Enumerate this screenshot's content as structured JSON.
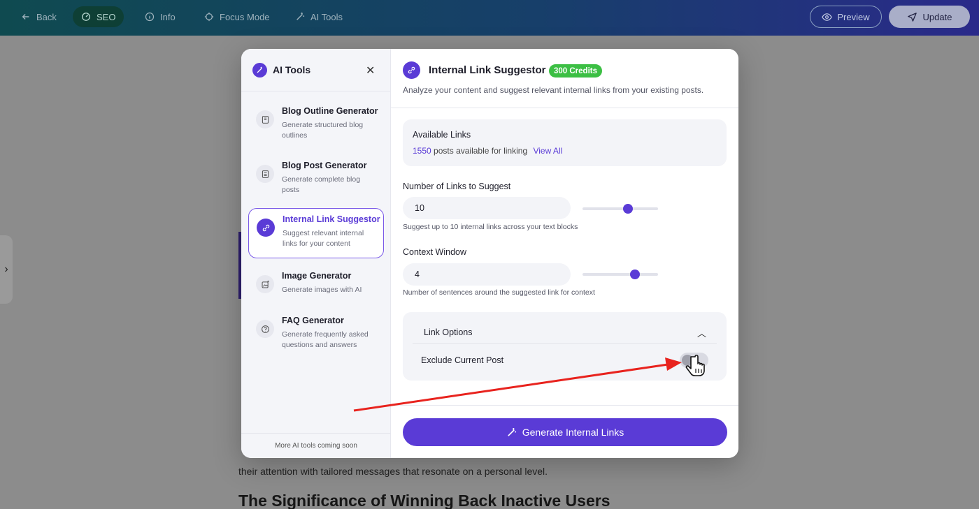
{
  "topbar": {
    "back": "Back",
    "seo": "SEO",
    "info": "Info",
    "focus": "Focus Mode",
    "ai_tools": "AI Tools",
    "preview": "Preview",
    "update": "Update"
  },
  "background": {
    "paragraph_line": "their attention with tailored messages that resonate on a personal level.",
    "heading": "The Significance of Winning Back Inactive Users"
  },
  "modal": {
    "left": {
      "title": "AI Tools",
      "tools": [
        {
          "title": "Blog Outline Generator",
          "desc": "Generate structured blog outlines",
          "icon": "document-icon"
        },
        {
          "title": "Blog Post Generator",
          "desc": "Generate complete blog posts",
          "icon": "list-doc-icon"
        },
        {
          "title": "Internal Link Suggestor",
          "desc": "Suggest relevant internal links for your content",
          "icon": "link-icon",
          "active": true
        },
        {
          "title": "Image Generator",
          "desc": "Generate images with AI",
          "icon": "image-sparkle-icon"
        },
        {
          "title": "FAQ Generator",
          "desc": "Generate frequently asked questions and answers",
          "icon": "question-icon"
        }
      ],
      "footer": "More AI tools coming soon"
    },
    "right": {
      "title": "Internal Link Suggestor",
      "credits": "300 Credits",
      "subtitle": "Analyze your content and suggest relevant internal links from your existing posts.",
      "available": {
        "label": "Available Links",
        "count": "1550",
        "text": "posts available for linking",
        "view_all": "View All"
      },
      "num_links": {
        "label": "Number of Links to Suggest",
        "value": "10",
        "hint": "Suggest up to 10 internal links across your text blocks",
        "slider_fraction": 0.62
      },
      "context": {
        "label": "Context Window",
        "value": "4",
        "hint": "Number of sentences around the suggested link for context",
        "slider_fraction": 0.72
      },
      "options": {
        "label": "Link Options",
        "exclude_label": "Exclude Current Post",
        "exclude_on": false
      },
      "generate_button": "Generate Internal Links"
    }
  },
  "colors": {
    "accent": "#5a3bd6",
    "credits_badge": "#3cbf44",
    "arrow": "#e8231e"
  }
}
